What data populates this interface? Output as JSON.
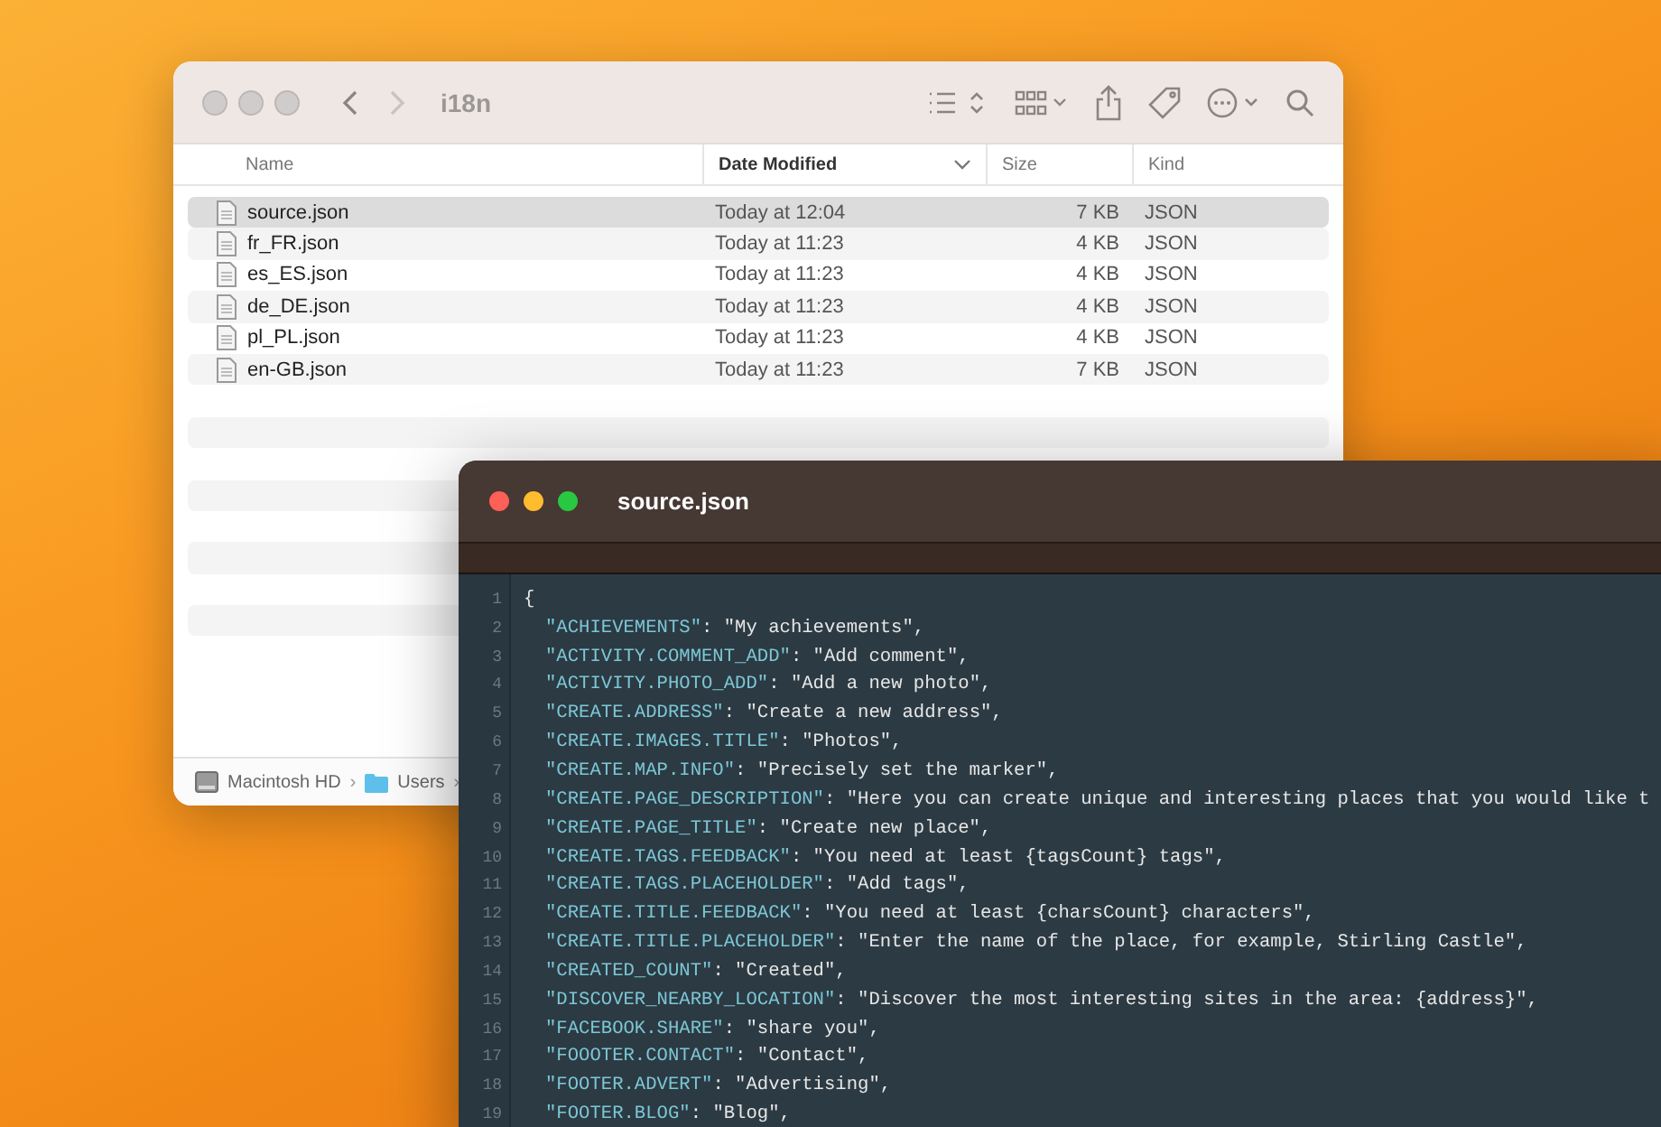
{
  "finder": {
    "title": "i18n",
    "columns": [
      {
        "label": "Name",
        "sorted": false
      },
      {
        "label": "Date Modified",
        "sorted": true
      },
      {
        "label": "Size",
        "sorted": false
      },
      {
        "label": "Kind",
        "sorted": false
      }
    ],
    "files": [
      {
        "name": "source.json",
        "date": "Today at 12:04",
        "size": "7 KB",
        "kind": "JSON",
        "selected": true
      },
      {
        "name": "fr_FR.json",
        "date": "Today at 11:23",
        "size": "4 KB",
        "kind": "JSON",
        "selected": false
      },
      {
        "name": "es_ES.json",
        "date": "Today at 11:23",
        "size": "4 KB",
        "kind": "JSON",
        "selected": false
      },
      {
        "name": "de_DE.json",
        "date": "Today at 11:23",
        "size": "4 KB",
        "kind": "JSON",
        "selected": false
      },
      {
        "name": "pl_PL.json",
        "date": "Today at 11:23",
        "size": "4 KB",
        "kind": "JSON",
        "selected": false
      },
      {
        "name": "en-GB.json",
        "date": "Today at 11:23",
        "size": "7 KB",
        "kind": "JSON",
        "selected": false
      }
    ],
    "path": [
      {
        "kind": "disk",
        "label": "Macintosh HD"
      },
      {
        "kind": "folder",
        "label": "Users"
      }
    ],
    "path_separators": [
      "›",
      "›"
    ]
  },
  "editor": {
    "title": "source.json",
    "lines": [
      {
        "number": "1",
        "kind": "brace",
        "rest": "{"
      },
      {
        "number": "2",
        "kind": "pair",
        "key": "\"ACHIEVEMENTS\"",
        "rest": ": \"My achievements\","
      },
      {
        "number": "3",
        "kind": "pair",
        "key": "\"ACTIVITY.COMMENT_ADD\"",
        "rest": ": \"Add comment\","
      },
      {
        "number": "4",
        "kind": "pair",
        "key": "\"ACTIVITY.PHOTO_ADD\"",
        "rest": ": \"Add a new photo\","
      },
      {
        "number": "5",
        "kind": "pair",
        "key": "\"CREATE.ADDRESS\"",
        "rest": ": \"Create a new address\","
      },
      {
        "number": "6",
        "kind": "pair",
        "key": "\"CREATE.IMAGES.TITLE\"",
        "rest": ": \"Photos\","
      },
      {
        "number": "7",
        "kind": "pair",
        "key": "\"CREATE.MAP.INFO\"",
        "rest": ": \"Precisely set the marker\","
      },
      {
        "number": "8",
        "kind": "pair",
        "key": "\"CREATE.PAGE_DESCRIPTION\"",
        "rest": ": \"Here you can create unique and interesting places that you would like t"
      },
      {
        "number": "9",
        "kind": "pair",
        "key": "\"CREATE.PAGE_TITLE\"",
        "rest": ": \"Create new place\","
      },
      {
        "number": "10",
        "kind": "pair",
        "key": "\"CREATE.TAGS.FEEDBACK\"",
        "rest": ": \"You need at least {tagsCount} tags\","
      },
      {
        "number": "11",
        "kind": "pair",
        "key": "\"CREATE.TAGS.PLACEHOLDER\"",
        "rest": ": \"Add tags\","
      },
      {
        "number": "12",
        "kind": "pair",
        "key": "\"CREATE.TITLE.FEEDBACK\"",
        "rest": ": \"You need at least {charsCount} characters\","
      },
      {
        "number": "13",
        "kind": "pair",
        "key": "\"CREATE.TITLE.PLACEHOLDER\"",
        "rest": ": \"Enter the name of the place, for example, Stirling Castle\","
      },
      {
        "number": "14",
        "kind": "pair",
        "key": "\"CREATED_COUNT\"",
        "rest": ": \"Created\","
      },
      {
        "number": "15",
        "kind": "pair",
        "key": "\"DISCOVER_NEARBY_LOCATION\"",
        "rest": ": \"Discover the most interesting sites in the area: {address}\","
      },
      {
        "number": "16",
        "kind": "pair",
        "key": "\"FACEBOOK.SHARE\"",
        "rest": ": \"share you\","
      },
      {
        "number": "17",
        "kind": "pair",
        "key": "\"FOOOTER.CONTACT\"",
        "rest": ": \"Contact\","
      },
      {
        "number": "18",
        "kind": "pair",
        "key": "\"FOOTER.ADVERT\"",
        "rest": ": \"Advertising\","
      },
      {
        "number": "19",
        "kind": "pair",
        "key": "\"FOOTER.BLOG\"",
        "rest": ": \"Blog\","
      }
    ]
  }
}
